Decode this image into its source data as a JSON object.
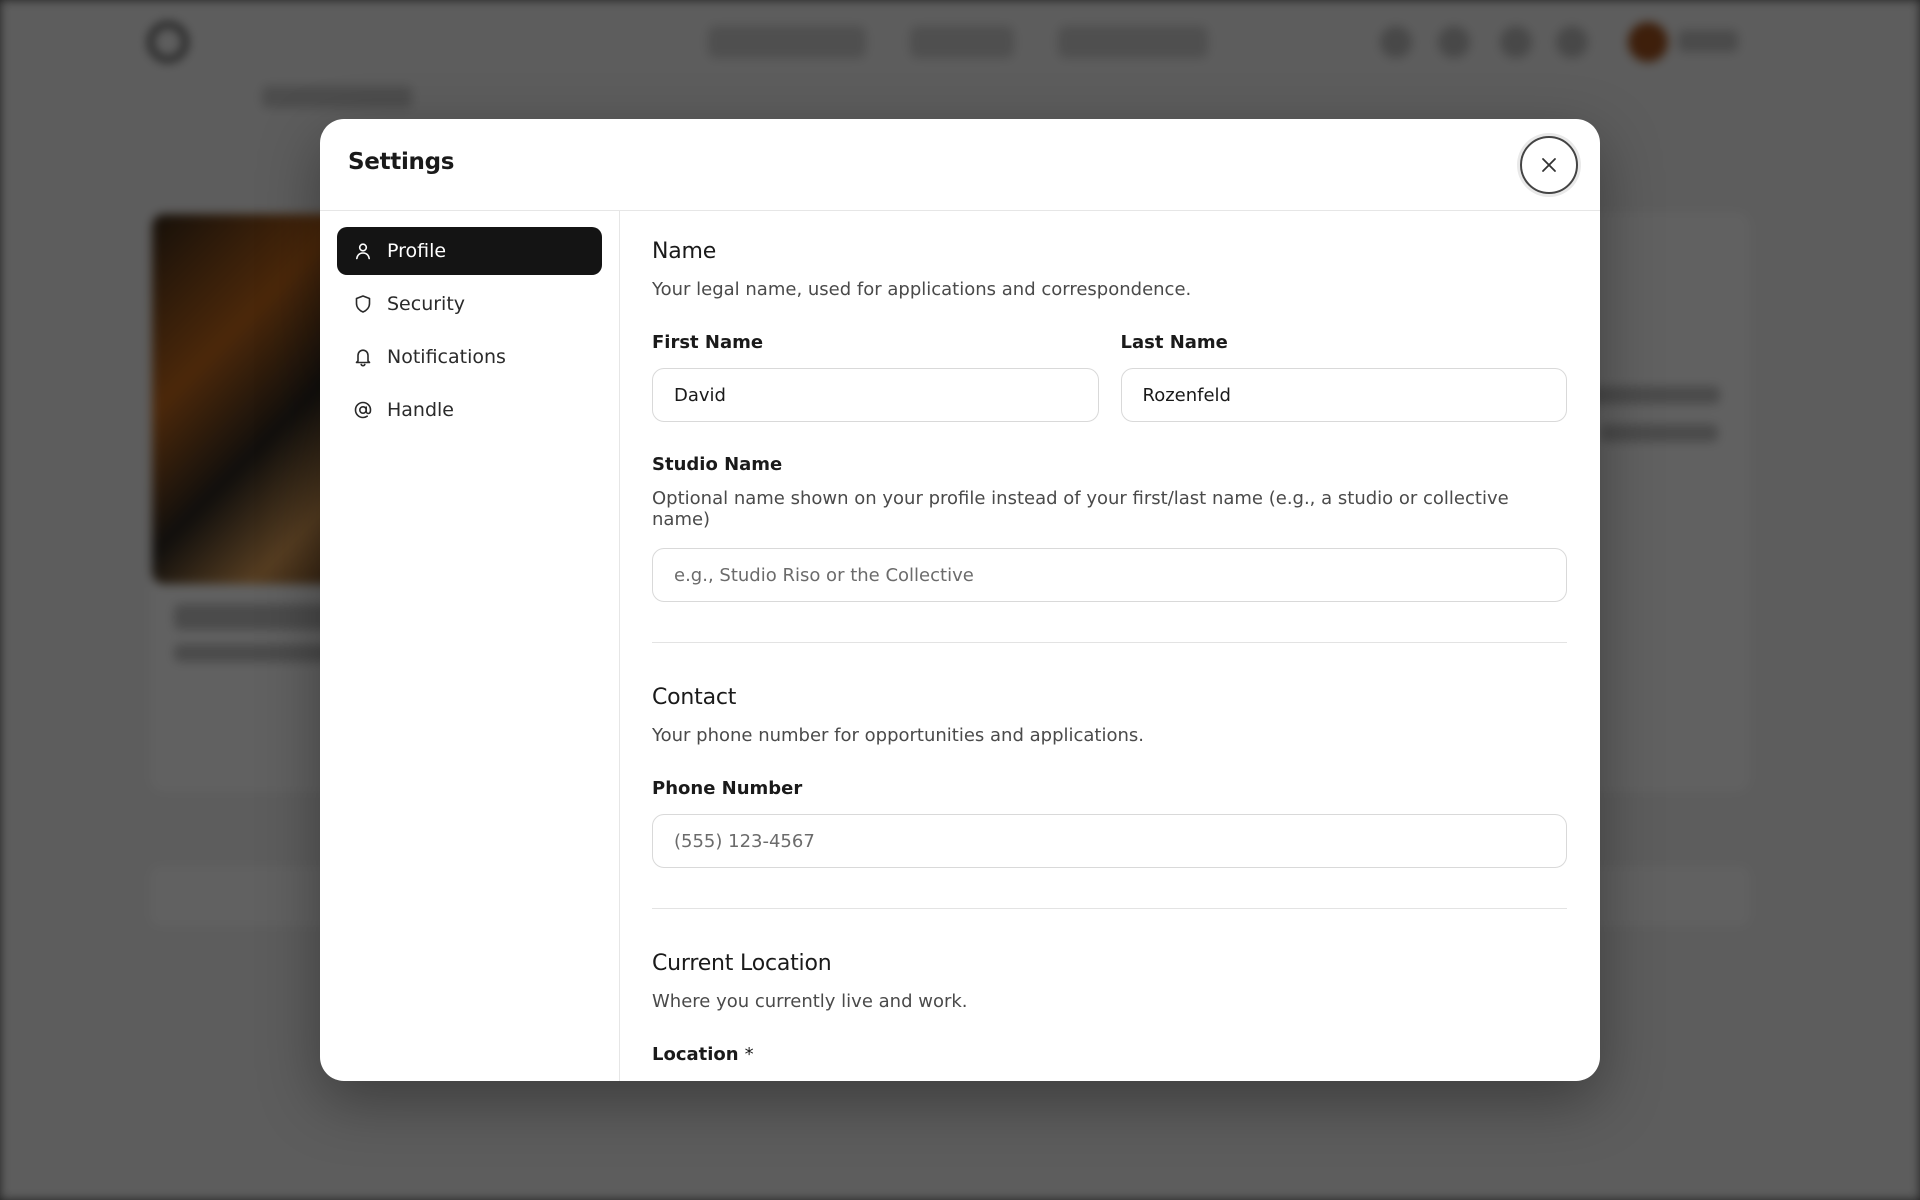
{
  "modal": {
    "title": "Settings"
  },
  "sidebar": {
    "items": [
      {
        "label": "Profile",
        "icon": "user-icon",
        "active": true
      },
      {
        "label": "Security",
        "icon": "shield-icon",
        "active": false
      },
      {
        "label": "Notifications",
        "icon": "bell-icon",
        "active": false
      },
      {
        "label": "Handle",
        "icon": "at-sign-icon",
        "active": false
      }
    ]
  },
  "name_section": {
    "title": "Name",
    "description": "Your legal name, used for applications and correspondence.",
    "first_name_label": "First Name",
    "first_name_value": "David",
    "last_name_label": "Last Name",
    "last_name_value": "Rozenfeld",
    "studio_label": "Studio Name",
    "studio_help": "Optional name shown on your profile instead of your first/last name (e.g., a studio or collective name)",
    "studio_placeholder": "e.g., Studio Riso or the Collective"
  },
  "contact_section": {
    "title": "Contact",
    "description": "Your phone number for opportunities and applications.",
    "phone_label": "Phone Number",
    "phone_placeholder": "(555) 123-4567"
  },
  "location_section": {
    "title": "Current Location",
    "description": "Where you currently live and work.",
    "location_label": "Location",
    "required_mark": "*"
  },
  "colors": {
    "active_item_bg": "#141414",
    "overlay": "#595959"
  }
}
